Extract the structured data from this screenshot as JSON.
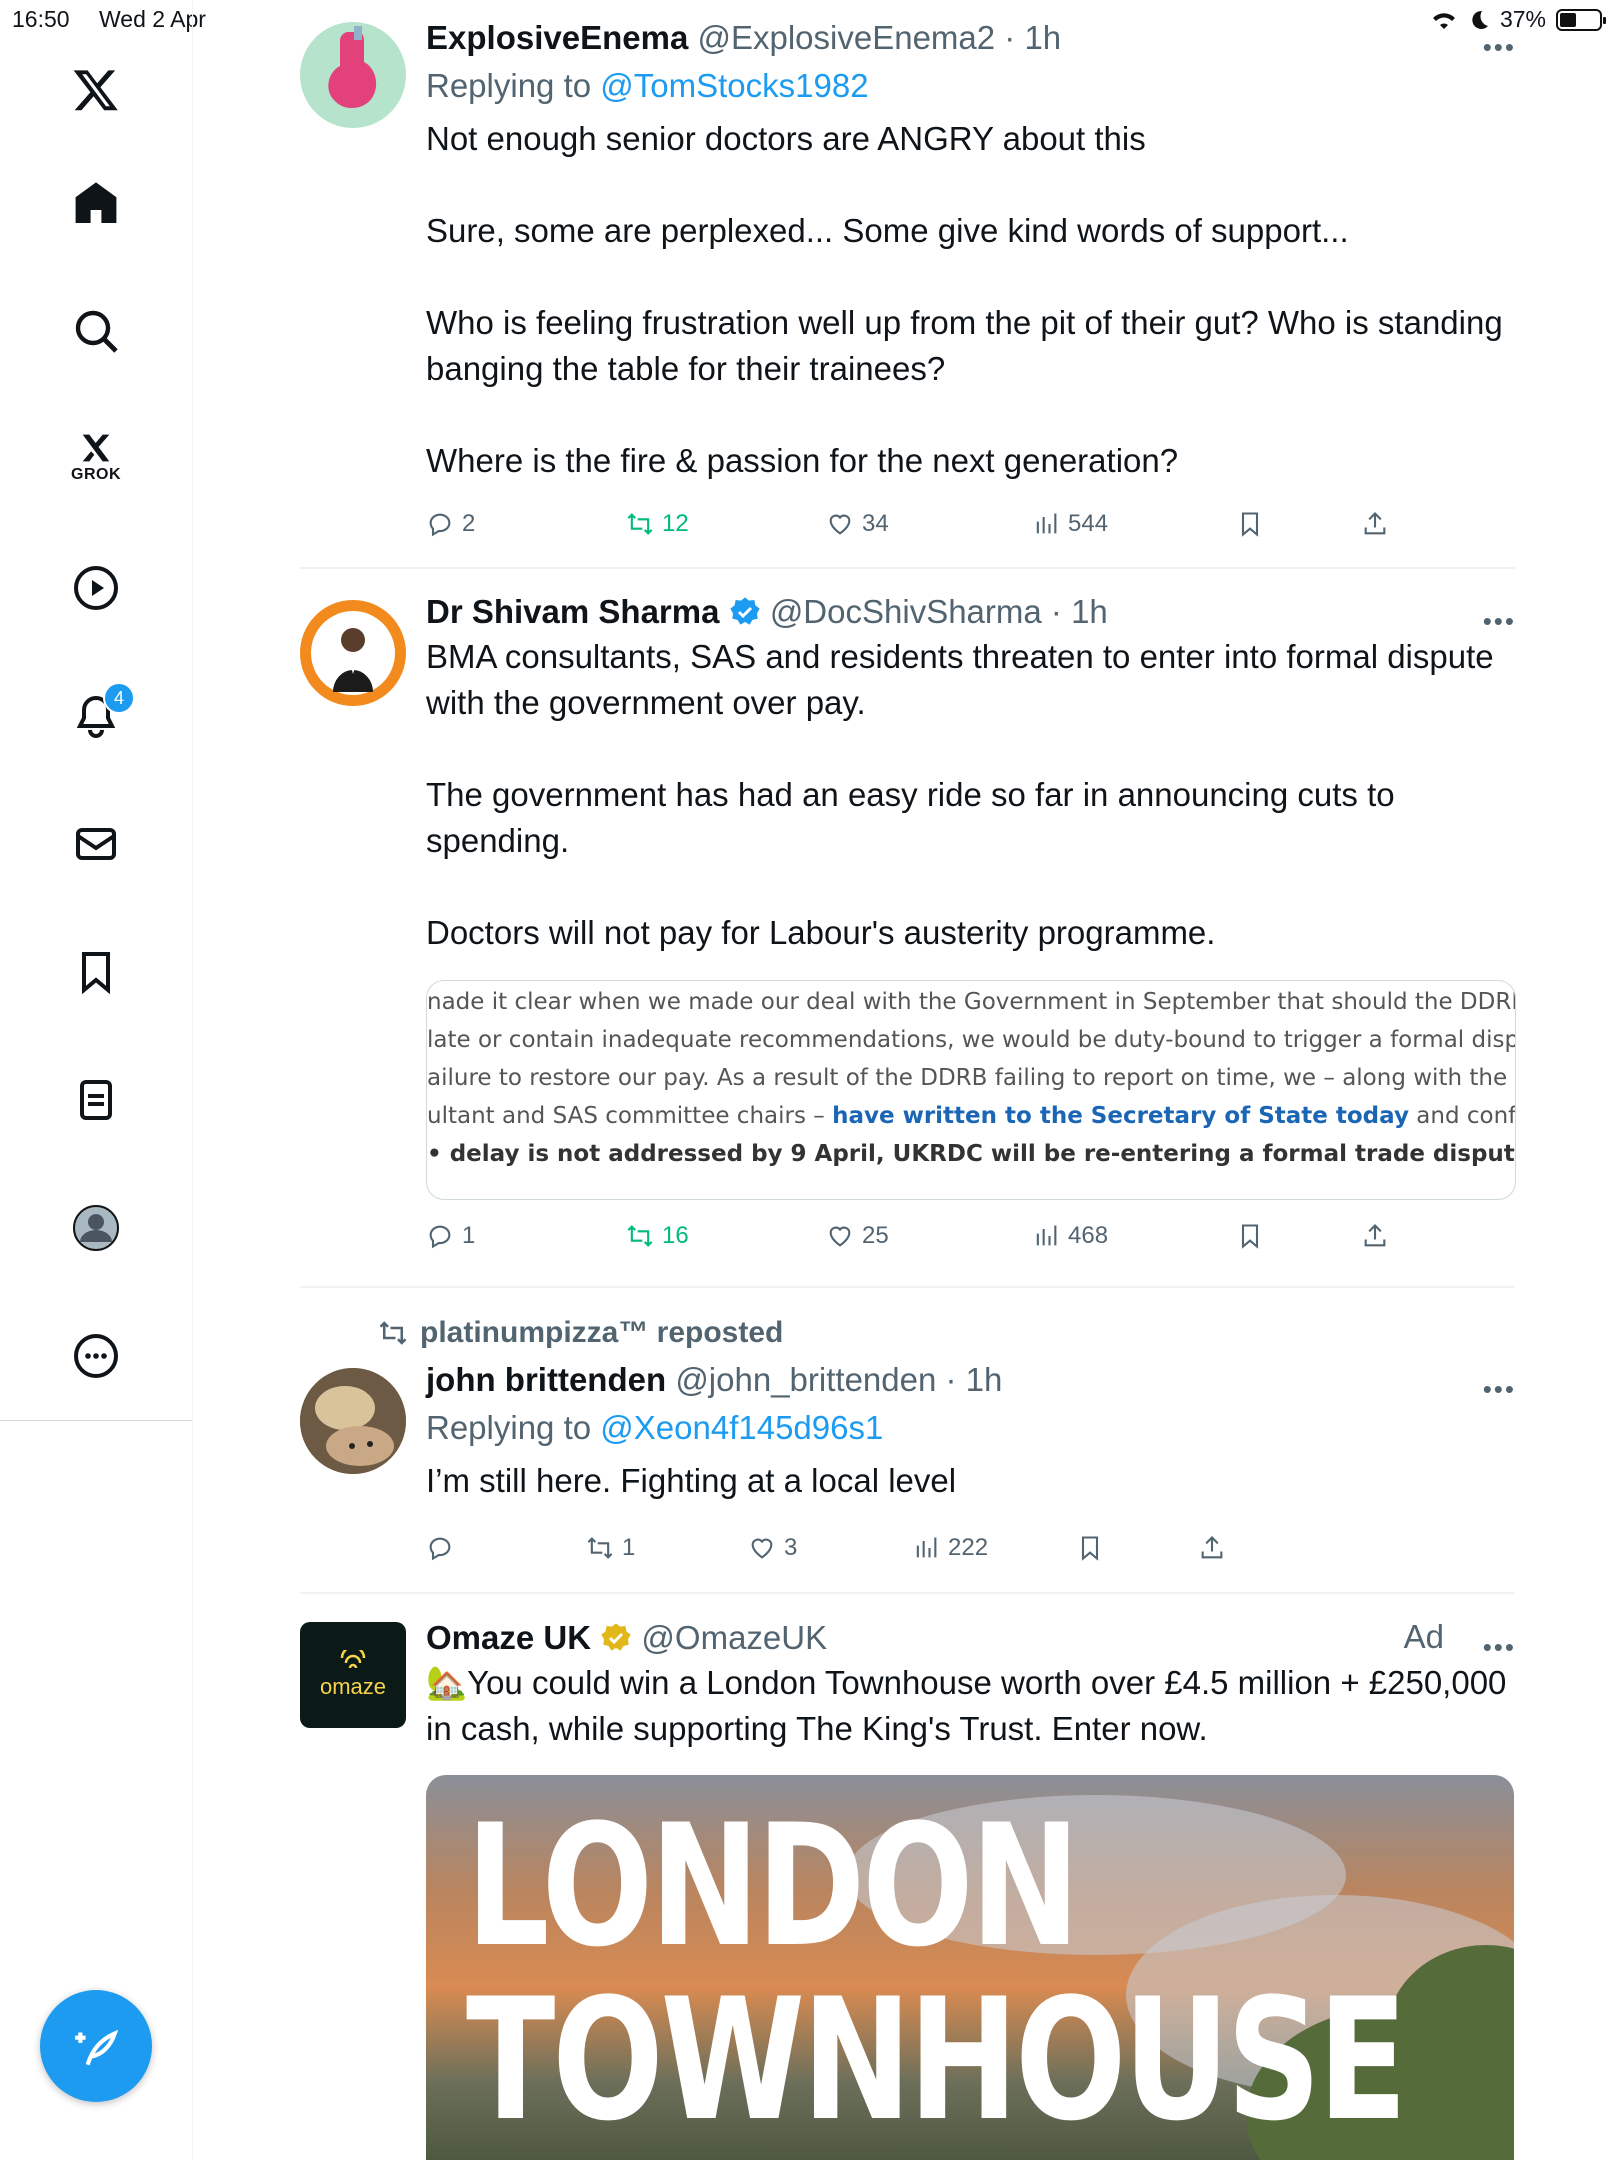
{
  "status_bar": {
    "time": "16:50",
    "date": "Wed 2 Apr",
    "battery": "37%"
  },
  "sidebar": {
    "items": [
      {
        "name": "x-logo",
        "label": ""
      },
      {
        "name": "home",
        "label": ""
      },
      {
        "name": "explore",
        "label": ""
      },
      {
        "name": "grok",
        "label": "GROK"
      },
      {
        "name": "video",
        "label": ""
      },
      {
        "name": "notifications",
        "label": "",
        "badge": "4"
      },
      {
        "name": "messages",
        "label": ""
      },
      {
        "name": "bookmarks",
        "label": ""
      },
      {
        "name": "lists",
        "label": ""
      },
      {
        "name": "profile",
        "label": ""
      },
      {
        "name": "more",
        "label": ""
      }
    ]
  },
  "feed": {
    "tweets": [
      {
        "name": "ExplosiveEnema",
        "handle": "@ExplosiveEnema2",
        "time": "· 1h",
        "replying_prefix": "Replying to ",
        "replying_to": "@TomStocks1982",
        "paragraphs": [
          "Not enough senior doctors are ANGRY about this",
          "Sure, some are perplexed... Some give kind words of support...",
          "Who is feeling frustration well up from the pit of their gut? Who is standing banging the table for their trainees?",
          "Where is the fire & passion for the next generation?"
        ],
        "replies": "2",
        "reposts": "12",
        "likes": "34",
        "views": "544"
      },
      {
        "name": "Dr Shivam Sharma",
        "handle": "@DocShivSharma",
        "time": "· 1h",
        "paragraphs": [
          "BMA consultants, SAS and residents threaten to enter into formal dispute with the government over pay.",
          "The government has had an easy ride so far in announcing cuts to spending.",
          "Doctors will not pay for Labour's austerity programme."
        ],
        "quote_lines": [
          "nade it clear when we made our deal with the Government in September that should the DDRB re|",
          " late or contain inadequate recommendations, we would be duty-bound to trigger a formal dispute",
          "ailure to restore our pay. As a result of the DDRB failing to report on time, we – along with the",
          "ultant and SAS committee chairs – ",
          "have written to the Secretary of State today",
          " and confirmed",
          "• delay is not addressed by 9 April, UKRDC will be re-entering a formal trade dispute",
          "."
        ],
        "replies": "1",
        "reposts": "16",
        "likes": "25",
        "views": "468"
      },
      {
        "repost_by": "platinumpizza™ reposted",
        "name": "john brittenden",
        "handle": "@john_brittenden",
        "time": "· 1h",
        "replying_prefix": "Replying to ",
        "replying_to": "@Xeon4f145d96s1",
        "paragraphs": [
          "I’m still here. Fighting at a local level"
        ],
        "replies": "",
        "reposts": "1",
        "likes": "3",
        "views": "222"
      },
      {
        "name": "Omaze UK",
        "handle": "@OmazeUK",
        "ad_label": "Ad",
        "avatar_text": "omaze",
        "paragraphs": [
          "🏡You could win a London Townhouse worth over £4.5 million + £250,000 in cash, while supporting The King's Trust. Enter now."
        ],
        "media_title_1": "LONDON",
        "media_title_2": "TOWNHOUSE"
      }
    ]
  },
  "colors": {
    "accent": "#1d9bf0",
    "repost_green": "#00ba7c",
    "muted": "#536471"
  }
}
